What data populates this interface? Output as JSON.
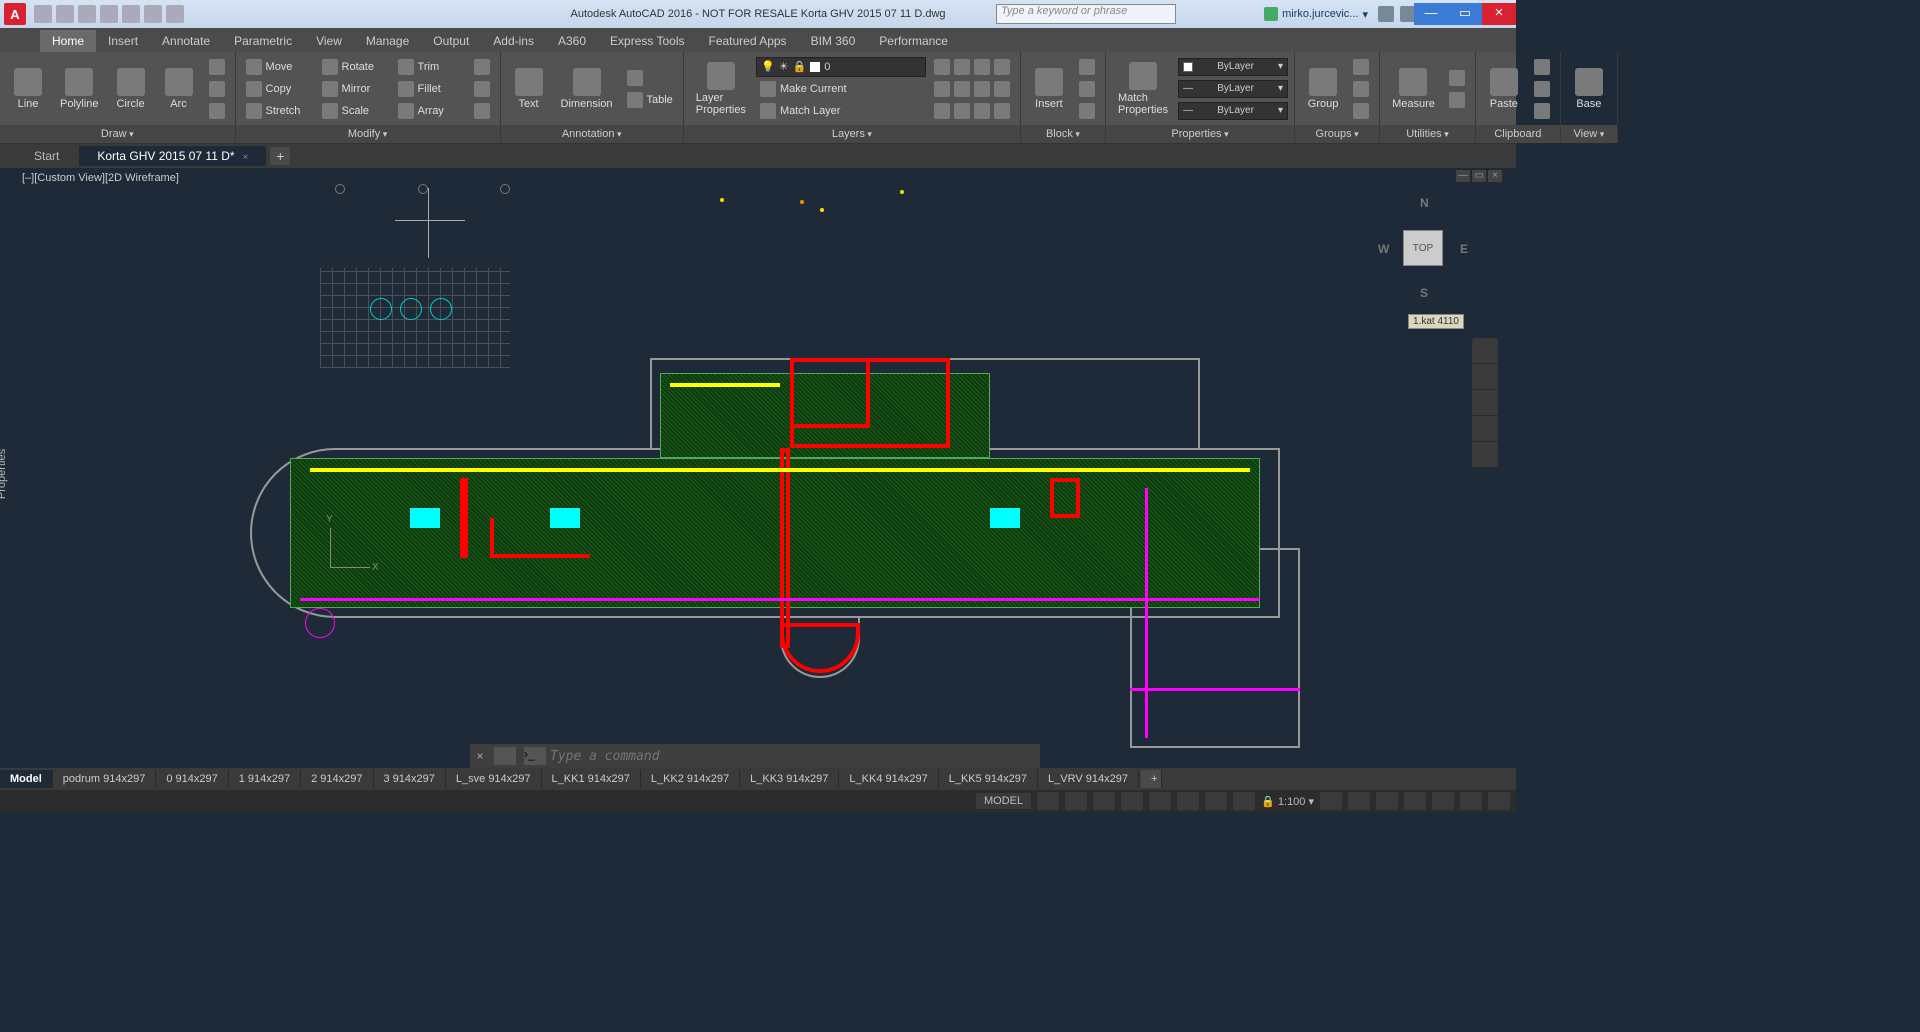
{
  "title": "Autodesk AutoCAD 2016 - NOT FOR RESALE    Korta GHV 2015 07 11 D.dwg",
  "search_placeholder": "Type a keyword or phrase",
  "user_label": "mirko.jurcevic...",
  "ribbon_tabs": [
    "Home",
    "Insert",
    "Annotate",
    "Parametric",
    "View",
    "Manage",
    "Output",
    "Add-ins",
    "A360",
    "Express Tools",
    "Featured Apps",
    "BIM 360",
    "Performance"
  ],
  "active_ribbon_tab": "Home",
  "panels": {
    "draw": {
      "title": "Draw",
      "items": [
        "Line",
        "Polyline",
        "Circle",
        "Arc"
      ]
    },
    "modify": {
      "title": "Modify",
      "rows": [
        [
          "Move",
          "Rotate",
          "Trim"
        ],
        [
          "Copy",
          "Mirror",
          "Fillet"
        ],
        [
          "Stretch",
          "Scale",
          "Array"
        ]
      ]
    },
    "annotation": {
      "title": "Annotation",
      "big": [
        "Text",
        "Dimension"
      ],
      "small": [
        "Table"
      ]
    },
    "layers": {
      "title": "Layers",
      "big": "Layer Properties",
      "rows": [
        "Make Current",
        "Match Layer"
      ],
      "layer_value": "0"
    },
    "block": {
      "title": "Block",
      "big": "Insert"
    },
    "properties": {
      "title": "Properties",
      "big": "Match Properties",
      "drops": [
        "ByLayer",
        "ByLayer",
        "ByLayer"
      ]
    },
    "groups": {
      "title": "Groups",
      "big": "Group"
    },
    "utilities": {
      "title": "Utilities",
      "big": "Measure"
    },
    "clipboard": {
      "title": "Clipboard",
      "big": "Paste"
    },
    "view": {
      "title": "View",
      "big": "Base"
    }
  },
  "file_tabs": {
    "start": "Start",
    "active": "Korta GHV 2015 07 11 D*"
  },
  "view_label": "[–][Custom View][2D Wireframe]",
  "properties_label": "Properties",
  "viewcube": {
    "top": "TOP",
    "n": "N",
    "s": "S",
    "e": "E",
    "w": "W"
  },
  "coord_tip": "1.kat 4110",
  "ucs": {
    "x": "X",
    "y": "Y"
  },
  "command_placeholder": "Type a command",
  "layout_tabs": [
    "Model",
    "podrum 914x297",
    "0 914x297",
    "1 914x297",
    "2 914x297",
    "3 914x297",
    "L_sve 914x297",
    "L_KK1 914x297",
    "L_KK2 914x297",
    "L_KK3 914x297",
    "L_KK4 914x297",
    "L_KK5 914x297",
    "L_VRV 914x297"
  ],
  "active_layout": "Model",
  "status": {
    "model": "MODEL",
    "scale": "1:100"
  }
}
